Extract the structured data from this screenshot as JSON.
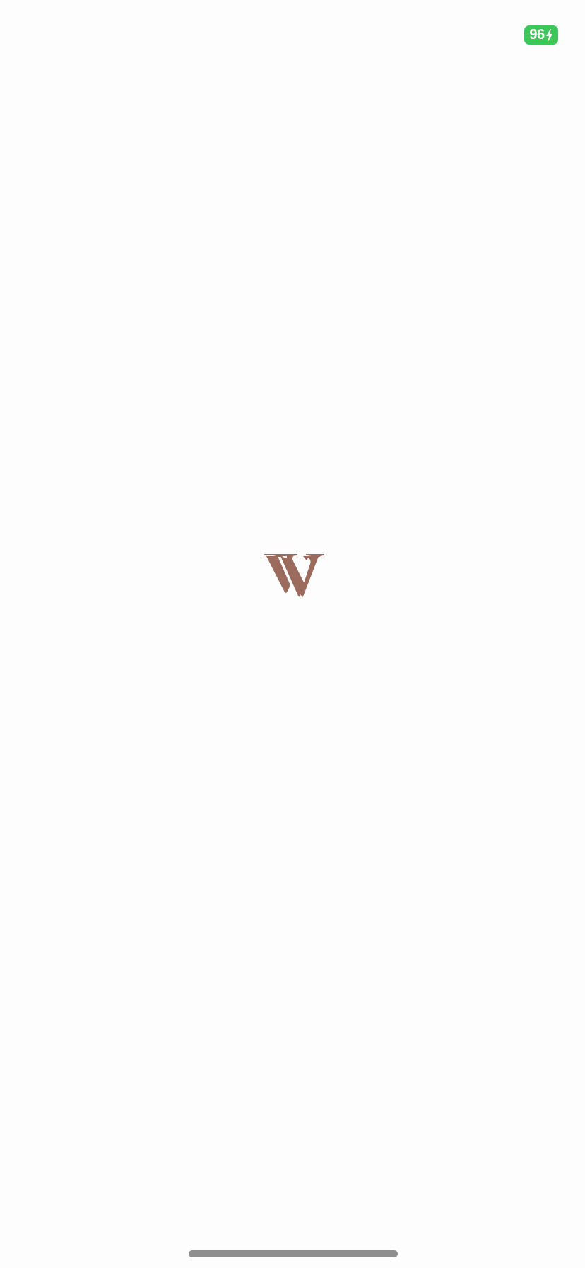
{
  "status_bar": {
    "battery": {
      "level": "96",
      "charging": true,
      "icon": "lightning-bolt-icon",
      "color": "#3dc75a"
    }
  },
  "splash": {
    "logo": {
      "icon": "w-monogram-logo",
      "color": "#9b6b5e"
    },
    "background_color": "#fdfdfd"
  },
  "home_indicator": {
    "color": "#8e8e8e"
  }
}
